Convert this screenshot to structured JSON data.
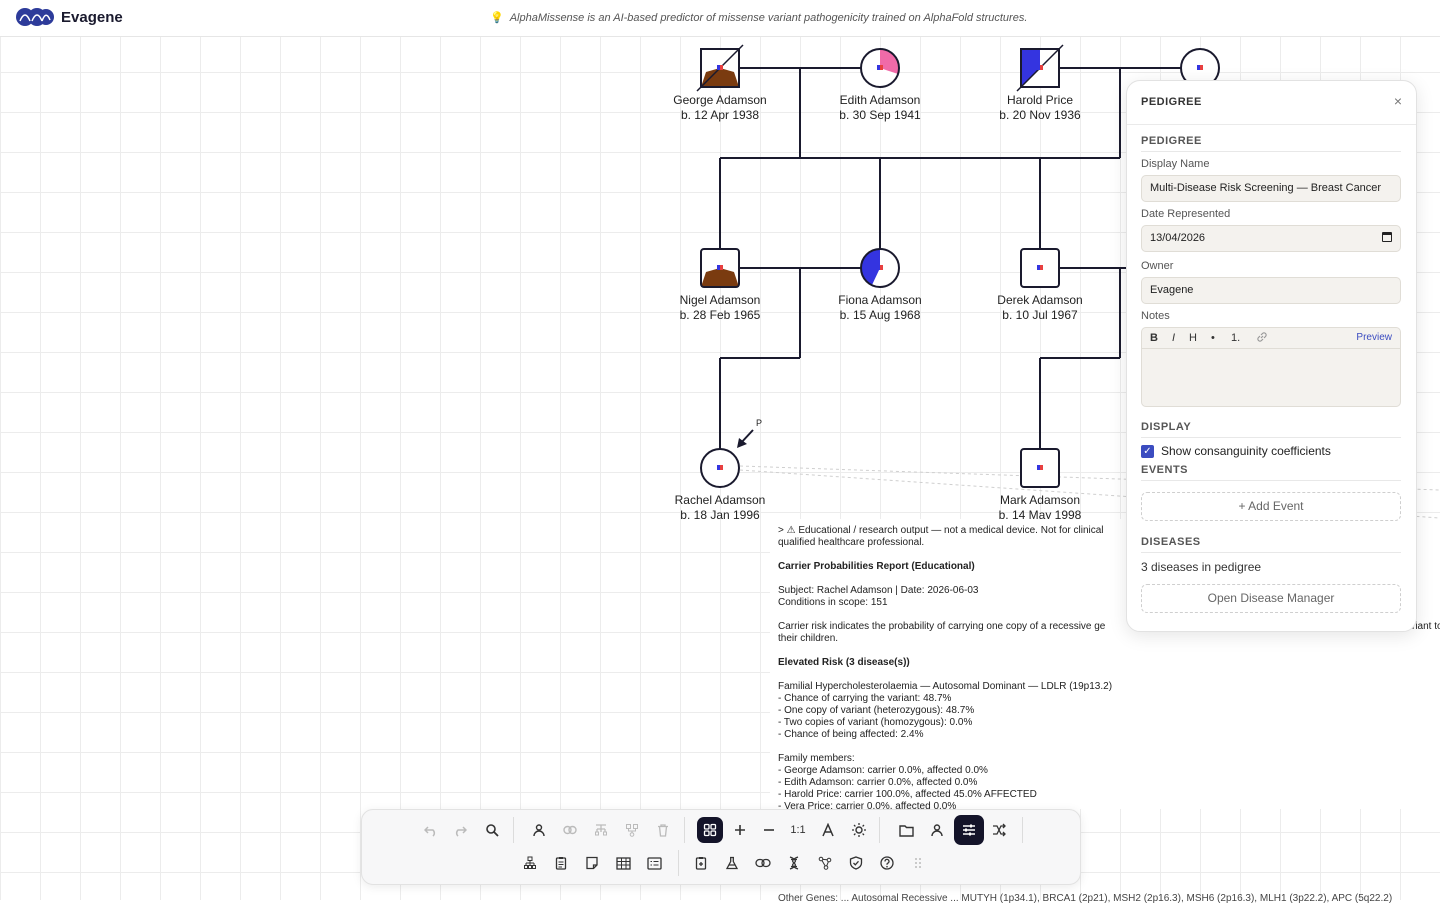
{
  "app": {
    "name": "Evagene"
  },
  "tip": {
    "text": "AlphaMissense is an AI-based predictor of missense variant pathogenicity trained on AlphaFold structures."
  },
  "colors": {
    "affected_brown": "#7a3b10",
    "affected_blue": "#3434e0",
    "affected_pink": "#f06aa8",
    "accent": "#3b4cc0",
    "toolbar_dark": "#14142a"
  },
  "people": [
    {
      "name": "George Adamson",
      "birth": "b. 12 Apr 1938"
    },
    {
      "name": "Edith Adamson",
      "birth": "b. 30 Sep 1941"
    },
    {
      "name": "Harold Price",
      "birth": "b. 20 Nov 1936"
    },
    {
      "name": "Nigel Adamson",
      "birth": "b. 28 Feb 1965"
    },
    {
      "name": "Fiona Adamson",
      "birth": "b. 15 Aug 1968"
    },
    {
      "name": "Derek Adamson",
      "birth": "b. 10 Jul 1967"
    },
    {
      "name": "Rachel Adamson",
      "birth": "b. 18 Jan 1996"
    },
    {
      "name": "Mark Adamson",
      "birth": "b. 14 May 1998"
    }
  ],
  "proband_marker": "P",
  "report": {
    "disclaimer": "> ⚠ Educational / research output — not a medical device. Not for clinical",
    "disclaimer2": "qualified healthcare professional.",
    "title": "Carrier Probabilities Report (Educational)",
    "subject": "Subject: Rachel Adamson | Date: 2026-06-03",
    "scope": "Conditions in scope: 151",
    "explain1": "Carrier risk indicates the probability of carrying one copy of a recessive ge",
    "explain1b": "riant to",
    "explain2": "their children.",
    "elevated": "Elevated Risk (3 disease(s))",
    "disease": "Familial Hypercholesterolaemia — Autosomal Dominant — LDLR (19p13.2)",
    "stats": [
      "- Chance of carrying the variant: 48.7%",
      "- One copy of variant (heterozygous): 48.7%",
      "- Two copies of variant (homozygous): 0.0%",
      "- Chance of being affected: 2.4%"
    ],
    "members_header": "Family members:",
    "members": [
      "- George Adamson: carrier 0.0%, affected 0.0%",
      "- Edith Adamson: carrier 0.0%, affected 0.0%",
      "- Harold Price: carrier 100.0%, affected 45.0% AFFECTED",
      "- Vera Price: carrier 0.0%, affected 0.0%"
    ],
    "tail": "Other Genes: ... Autosomal Recessive ... MUTYH (1p34.1), BRCA1 (2p21), MSH2 (2p16.3), MSH6 (2p16.3), MLH1 (3p22.2), APC (5q22.2)"
  },
  "panel": {
    "title": "PEDIGREE",
    "close": "×",
    "section_pedigree": "PEDIGREE",
    "display_name_label": "Display Name",
    "display_name_value": "Multi-Disease Risk Screening — Breast Cancer",
    "date_label": "Date Represented",
    "date_value": "13/04/2026",
    "owner_label": "Owner",
    "owner_value": "Evagene",
    "notes_label": "Notes",
    "notes_tools": {
      "bold": "B",
      "italic": "I",
      "heading": "H",
      "bullet": "•",
      "numbered": "1.",
      "preview": "Preview"
    },
    "section_display": "DISPLAY",
    "consanguinity_label": "Show consanguinity coefficients",
    "consanguinity_checked": true,
    "section_events": "EVENTS",
    "add_event": "+ Add Event",
    "section_diseases": "DISEASES",
    "diseases_count": "3 diseases in pedigree",
    "open_disease_manager": "Open Disease Manager"
  },
  "toolbar": {
    "zoom_reset": "1:1",
    "row1_icons": [
      "undo-icon",
      "redo-icon",
      "search-icon",
      "add-person-icon",
      "add-partner-icon",
      "add-children-icon",
      "add-sibling-icon",
      "delete-icon",
      "layout-grid-icon",
      "zoom-in-icon",
      "zoom-out-icon",
      "text-size-icon",
      "theme-icon",
      "folder-icon",
      "user-icon",
      "settings-sliders-icon",
      "shuffle-icon"
    ],
    "row2_icons": [
      "tree-icon",
      "clipboard-icon",
      "note-icon",
      "table-icon",
      "form-icon",
      "report-icon",
      "flask-icon",
      "link-icon",
      "dna-icon",
      "share-icon",
      "shield-icon",
      "help-icon",
      "drag-handle-icon"
    ]
  }
}
